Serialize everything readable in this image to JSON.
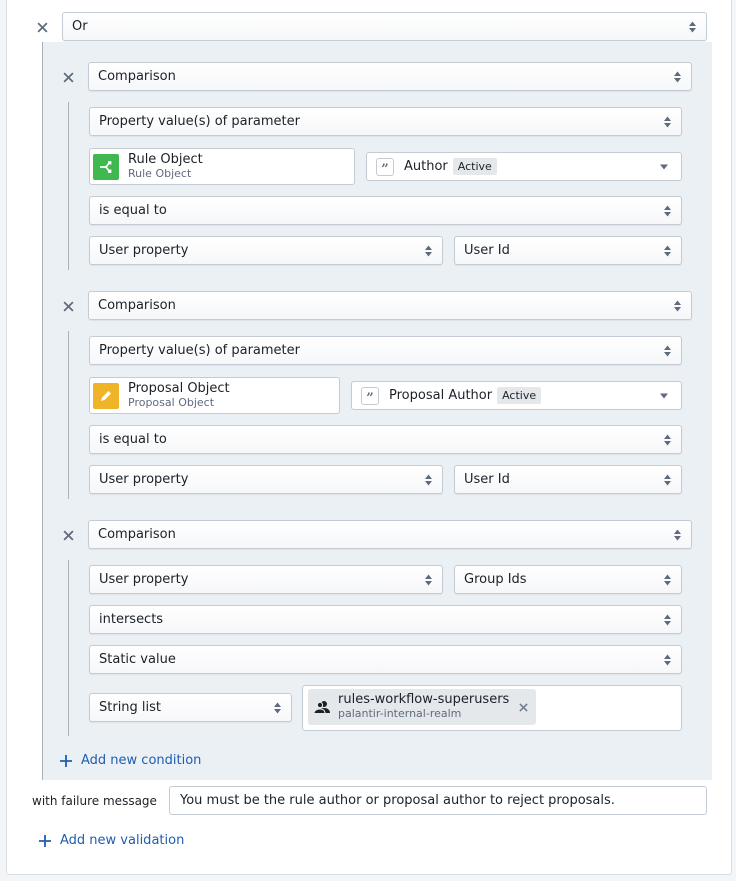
{
  "root": {
    "operator": "Or",
    "conditions": [
      {
        "type": "Comparison",
        "left_source": "Property value(s) of parameter",
        "object": {
          "title": "Rule Object",
          "subtitle": "Rule Object",
          "icon": "branch-icon",
          "color": "#3fb84f"
        },
        "property": {
          "name": "Author",
          "badge": "Active"
        },
        "operator": "is equal to",
        "right_source": "User property",
        "right_value": "User Id"
      },
      {
        "type": "Comparison",
        "left_source": "Property value(s) of parameter",
        "object": {
          "title": "Proposal Object",
          "subtitle": "Proposal Object",
          "icon": "pencil-icon",
          "color": "#f0b429"
        },
        "property": {
          "name": "Proposal Author",
          "badge": "Active"
        },
        "operator": "is equal to",
        "right_source": "User property",
        "right_value": "User Id"
      },
      {
        "type": "Comparison",
        "left_source": "User property",
        "left_value": "Group Ids",
        "operator": "intersects",
        "right_source": "Static value",
        "value_type": "String list",
        "tags": [
          {
            "name": "rules-workflow-superusers",
            "realm": "palantir-internal-realm",
            "icon": "group-icon"
          }
        ]
      }
    ],
    "add_condition_label": "Add new condition"
  },
  "failure_message": {
    "label": "with failure message",
    "value": "You must be the rule author or proposal author to reject proposals."
  },
  "add_validation_label": "Add new validation",
  "colors": {
    "link": "#215db0",
    "group_bg": "#ebf0f4"
  }
}
